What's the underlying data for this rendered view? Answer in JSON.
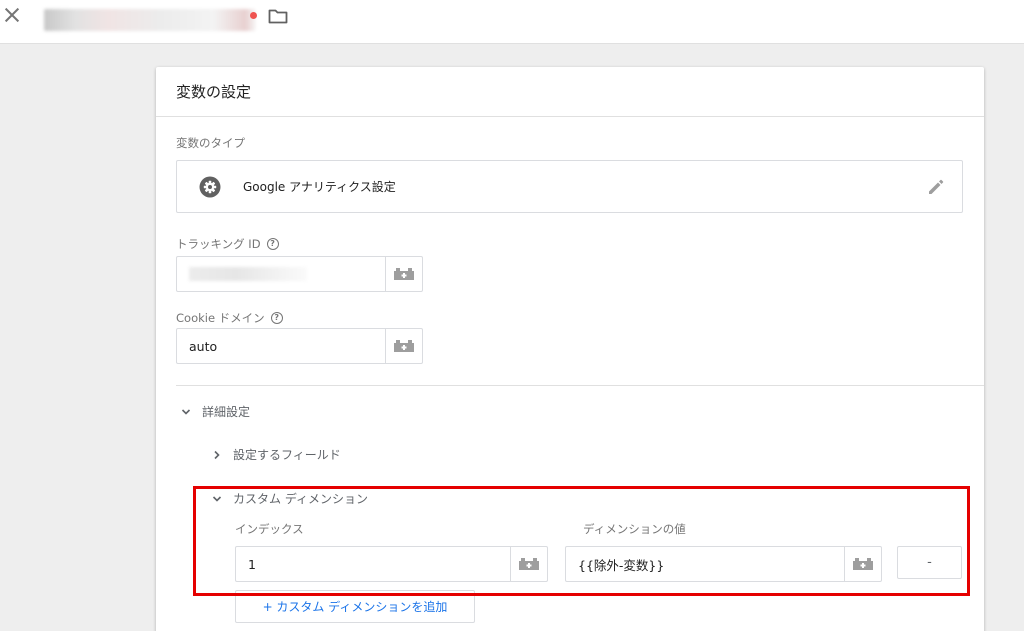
{
  "topbar": {
    "close_icon": "close-icon",
    "title": "",
    "folder_icon": "folder-icon"
  },
  "card": {
    "title": "変数の設定",
    "variable_type": {
      "label": "変数のタイプ",
      "name": "Google アナリティクス設定",
      "icon": "gear-icon",
      "edit_icon": "pencil-icon"
    },
    "tracking_id": {
      "label": "トラッキング ID",
      "value": "",
      "help_icon": "help-icon"
    },
    "cookie_domain": {
      "label": "Cookie ドメイン",
      "value": "auto",
      "help_icon": "help-icon"
    },
    "advanced": {
      "label": "詳細設定",
      "expanded": true,
      "fields_to_set": {
        "label": "設定するフィールド",
        "expanded": false
      },
      "custom_dimensions": {
        "label": "カスタム ディメンション",
        "expanded": true,
        "index_header": "インデックス",
        "value_header": "ディメンションの値",
        "rows": [
          {
            "index": "1",
            "value": "{{除外-変数}}",
            "remove_label": "-"
          }
        ],
        "add_label": "+ カスタム ディメンションを追加"
      }
    }
  },
  "colors": {
    "accent": "#1a73e8",
    "highlight": "#e50000",
    "background": "#eeeeee"
  }
}
